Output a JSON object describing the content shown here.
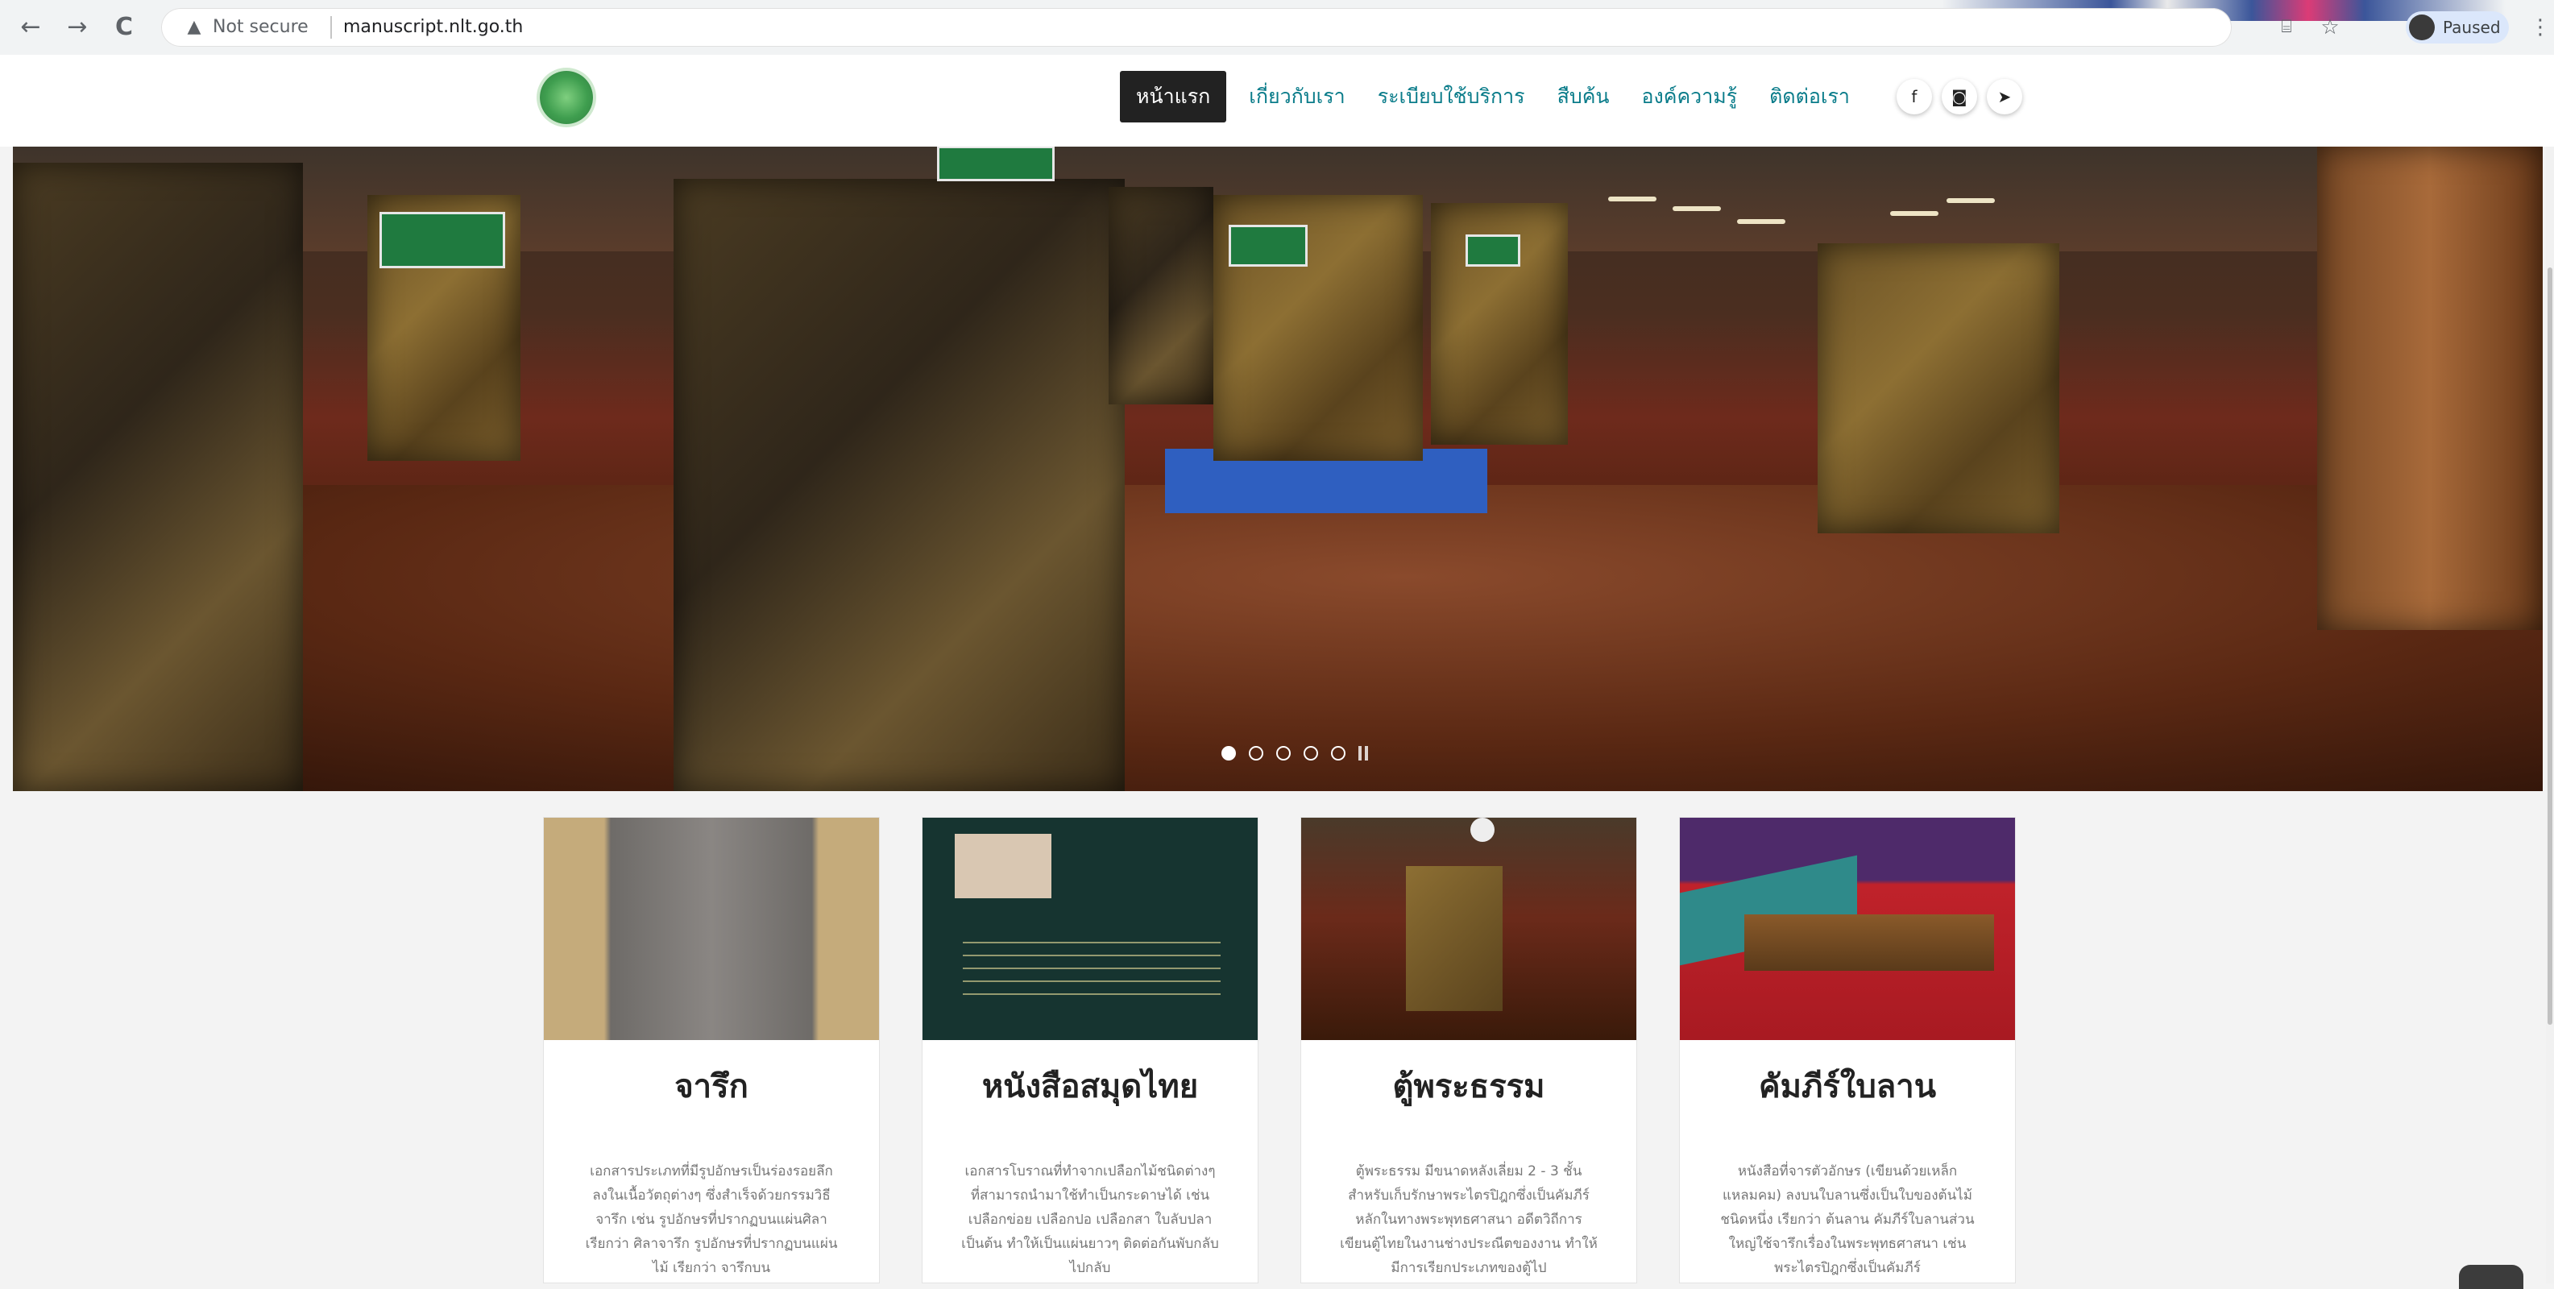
{
  "browser": {
    "back_icon": "←",
    "forward_icon": "→",
    "reload_icon": "C",
    "security_icon": "▲",
    "security_label": "Not secure",
    "url": "manuscript.nlt.go.th",
    "translate_icon": "⌸",
    "star_icon": "☆",
    "profile_label": "Paused",
    "menu_icon": "⋮"
  },
  "site": {
    "nav": [
      {
        "label": "หน้าแรก",
        "active": true
      },
      {
        "label": "เกี่ยวกับเรา"
      },
      {
        "label": "ระเบียบใช้บริการ"
      },
      {
        "label": "สืบค้น"
      },
      {
        "label": "องค์ความรู้"
      },
      {
        "label": "ติดต่อเรา"
      }
    ],
    "social": [
      {
        "icon": "facebook-icon",
        "glyph": "f"
      },
      {
        "icon": "instagram-icon",
        "glyph": "◙"
      },
      {
        "icon": "twitter-icon",
        "glyph": "➤"
      }
    ]
  },
  "hero": {
    "slide_count": 5,
    "active_slide": 1
  },
  "cards": [
    {
      "title": "จารึก",
      "description": "เอกสารประเภทที่มีรูปอักษรเป็นร่องรอยลึกลงในเนื้อวัตถุต่างๆ ซึ่งสำเร็จด้วยกรรมวิธีจารึก เช่น รูปอักษรที่ปรากฏบนแผ่นศิลา เรียกว่า ศิลาจารึก รูปอักษรที่ปรากฏบนแผ่นไม้ เรียกว่า จารึกบน"
    },
    {
      "title": "หนังสือสมุดไทย",
      "description": "เอกสารโบราณที่ทำจากเปลือกไม้ชนิดต่างๆ ที่สามารถนำมาใช้ทำเป็นกระดาษได้ เช่น เปลือกข่อย เปลือกปอ เปลือกสา ใบลับปลา เป็นต้น ทำให้เป็นแผ่นยาวๆ ติดต่อกันพับกลับไปกลับ"
    },
    {
      "title": "ตู้พระธรรม",
      "description": "ตู้พระธรรม มีขนาดหลังเลี่ยม 2 - 3 ชั้น สำหรับเก็บรักษาพระไตรปิฎกซึ่งเป็นคัมภีร์หลักในทางพระพุทธศาสนา อดีตวิถีการเขียนตู้ไทยในงานช่างประณีตของงาน ทำให้มีการเรียกประเภทของตู้ไป"
    },
    {
      "title": "คัมภีร์ใบลาน",
      "description": "หนังสือที่จารตัวอักษร (เขียนด้วยเหล็กแหลมคม) ลงบนใบลานซึ่งเป็นใบของต้นไม้ชนิดหนึ่ง เรียกว่า ต้นลาน คัมภีร์ใบลานส่วนใหญ่ใช้จารึกเรื่องในพระพุทธศาสนา เช่น พระไตรปิฎกซึ่งเป็นคัมภีร์"
    }
  ]
}
